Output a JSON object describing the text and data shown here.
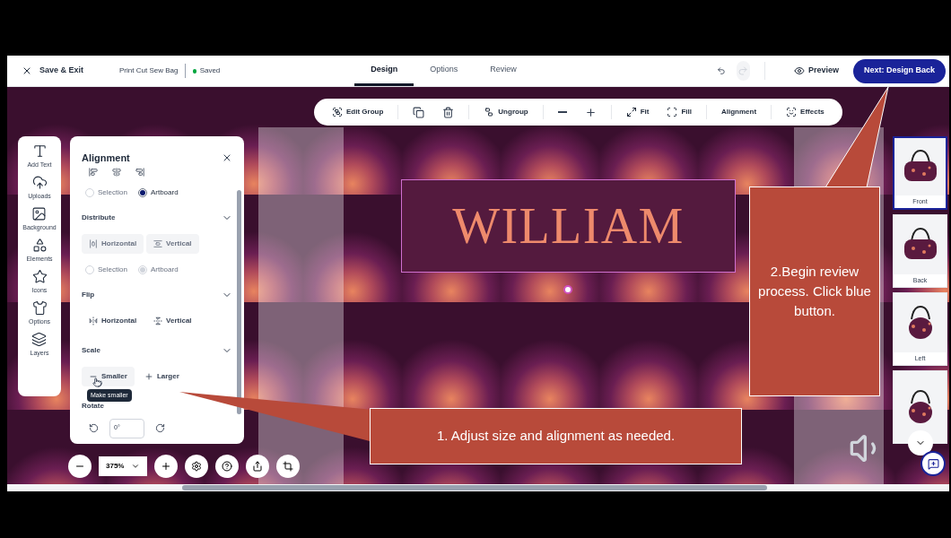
{
  "header": {
    "exit": "Save & Exit",
    "project": "Print Cut Sew Bag",
    "status": "Saved",
    "tabs": [
      {
        "label": "Design",
        "selected": true
      },
      {
        "label": "Options",
        "selected": false
      },
      {
        "label": "Review",
        "selected": false
      }
    ],
    "preview": "Preview",
    "next": "Next: Design Back"
  },
  "toolbar": [
    {
      "kind": "labeled",
      "label": "Edit Group"
    },
    {
      "kind": "divider"
    },
    {
      "kind": "icon"
    },
    {
      "kind": "icon"
    },
    {
      "kind": "divider"
    },
    {
      "kind": "labeled",
      "label": "Ungroup"
    },
    {
      "kind": "divider"
    },
    {
      "kind": "icon"
    },
    {
      "kind": "icon"
    },
    {
      "kind": "divider"
    },
    {
      "kind": "labeled",
      "label": "Fit"
    },
    {
      "kind": "labeled",
      "label": "Fill"
    },
    {
      "kind": "divider"
    },
    {
      "kind": "labeled",
      "label": "Alignment"
    },
    {
      "kind": "divider"
    },
    {
      "kind": "labeled",
      "label": "Effects"
    }
  ],
  "sidebar": [
    "Add Text",
    "Uploads",
    "Background",
    "Elements",
    "Icons",
    "Options",
    "Layers"
  ],
  "panel": {
    "title": "Alignment",
    "scope": [
      {
        "label": "Selection",
        "selected": false,
        "disabled": true
      },
      {
        "label": "Artboard",
        "selected": true,
        "disabled": false
      }
    ],
    "sections": [
      {
        "kind": "buttons",
        "title": "Distribute",
        "buttons": [
          {
            "label": "Horizontal",
            "disabled": true,
            "hovered": false
          },
          {
            "label": "Vertical",
            "disabled": true,
            "hovered": false
          }
        ],
        "scope": [
          {
            "label": "Selection",
            "selected": false,
            "disabled": true
          },
          {
            "label": "Artboard",
            "selected": true,
            "disabled": true
          }
        ]
      },
      {
        "kind": "buttons",
        "title": "Flip",
        "buttons": [
          {
            "label": "Horizontal",
            "disabled": false,
            "hovered": false
          },
          {
            "label": "Vertical",
            "disabled": false,
            "hovered": false
          }
        ]
      },
      {
        "kind": "buttons",
        "title": "Scale",
        "buttons": [
          {
            "label": "Smaller",
            "disabled": false,
            "hovered": true,
            "tooltip": "Make smaller"
          },
          {
            "label": "Larger",
            "disabled": false,
            "hovered": false
          }
        ]
      },
      {
        "kind": "rotate",
        "title": "Rotate",
        "value": "0°"
      }
    ]
  },
  "canvas": {
    "name_text": "WILLIAM"
  },
  "views": [
    {
      "label": "Front",
      "selected": true
    },
    {
      "label": "Back",
      "selected": false
    },
    {
      "label": "Left",
      "selected": false
    },
    {
      "selected": false
    }
  ],
  "zoom": "375%",
  "callouts": [
    "1. Adjust size and alignment as needed.",
    "2.Begin review process. Click blue button."
  ]
}
